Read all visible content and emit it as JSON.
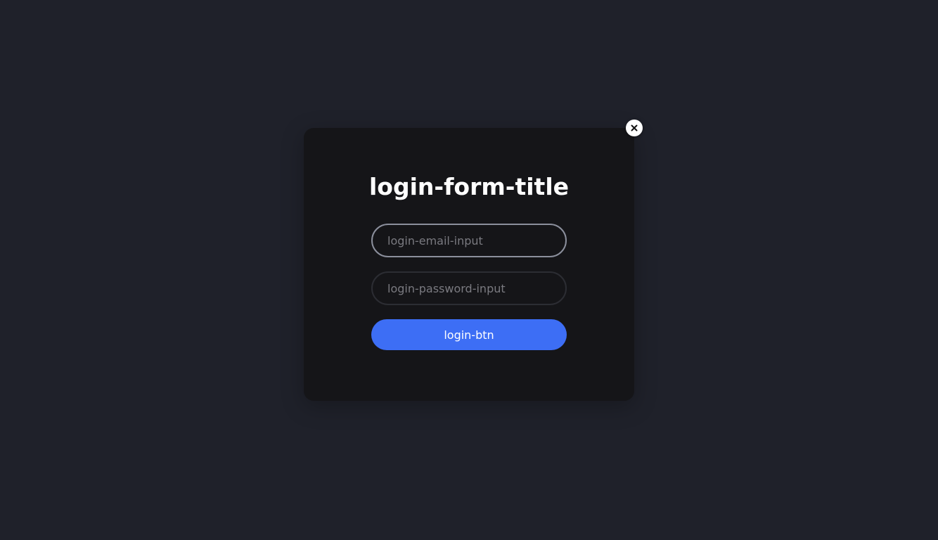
{
  "modal": {
    "title": "login-form-title",
    "email_input": {
      "value": "",
      "placeholder": "login-email-input"
    },
    "password_input": {
      "value": "",
      "placeholder": "login-password-input"
    },
    "submit_label": "login-btn",
    "close_icon": "close-icon"
  },
  "colors": {
    "background": "#1f212a",
    "modal_background": "#151518",
    "accent": "#3d6ef5"
  }
}
